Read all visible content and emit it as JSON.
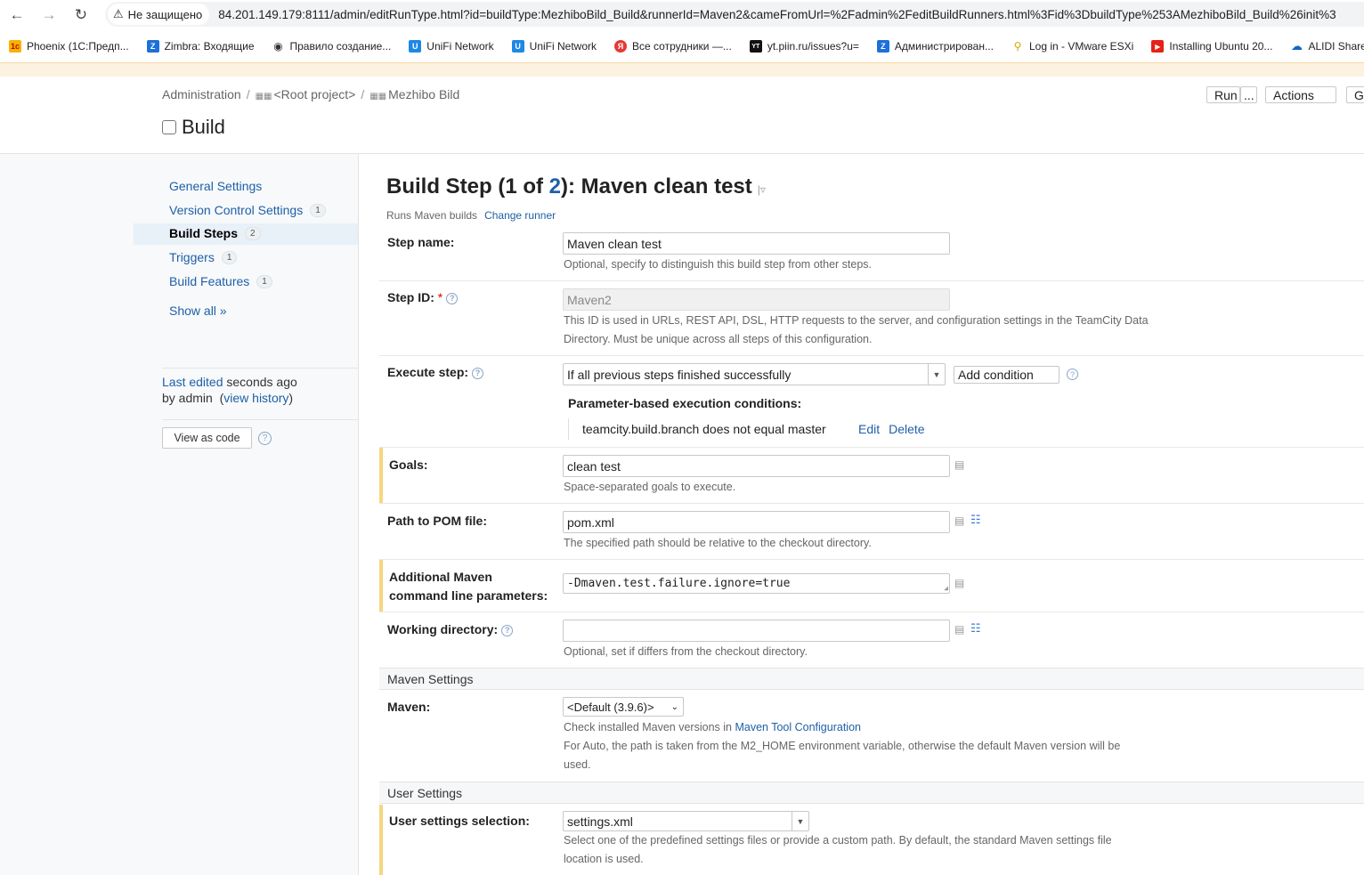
{
  "browser": {
    "security_label": "Не защищено",
    "url": "84.201.149.179:8111/admin/editRunType.html?id=buildType:MezhiboBild_Build&runnerId=Maven2&cameFromUrl=%2Fadmin%2FeditBuildRunners.html%3Fid%3DbuildType%253AMezhiboBild_Build%26init%3"
  },
  "bookmarks": [
    {
      "label": "Phoenix (1С:Предп...",
      "color": "#f5b400",
      "glyph": "1c"
    },
    {
      "label": "Zimbra: Входящие",
      "color": "#1e6fd9",
      "glyph": "Z"
    },
    {
      "label": "Правило создание...",
      "color": "#333333",
      "glyph": "◉"
    },
    {
      "label": "UniFi Network",
      "color": "#1e88e5",
      "glyph": "U"
    },
    {
      "label": "UniFi Network",
      "color": "#1e88e5",
      "glyph": "U"
    },
    {
      "label": "Все сотрудники —...",
      "color": "#e53935",
      "glyph": "Я"
    },
    {
      "label": "yt.piin.ru/issues?u=",
      "color": "#111111",
      "glyph": "YT"
    },
    {
      "label": "Администрирован...",
      "color": "#1e6fd9",
      "glyph": "Z"
    },
    {
      "label": "Log in - VMware ESXi",
      "color": "#f2c200",
      "glyph": "⚲"
    },
    {
      "label": "Installing Ubuntu 20...",
      "color": "#e62117",
      "glyph": "▶"
    },
    {
      "label": "ALIDI Share –",
      "color": "#1565c0",
      "glyph": "☁"
    }
  ],
  "breadcrumb": {
    "admin": "Administration",
    "sep": "/",
    "root": "<Root project>",
    "project": "Mezhibo Bild"
  },
  "page_title": "Build",
  "header_buttons": {
    "run": "Run",
    "run_more": "...",
    "actions": "Actions",
    "go": "Go"
  },
  "sidebar": {
    "items": [
      {
        "label": "General Settings",
        "badge": ""
      },
      {
        "label": "Version Control Settings",
        "badge": "1"
      },
      {
        "label": "Build Steps",
        "badge": "2"
      },
      {
        "label": "Triggers",
        "badge": "1"
      },
      {
        "label": "Build Features",
        "badge": "1"
      },
      {
        "label": "Show all »",
        "badge": ""
      }
    ],
    "last_edited_link": "Last edited",
    "last_edited_when": " seconds ago",
    "by_admin": "by admin",
    "view_history": "view history",
    "view_as_code": "View as code"
  },
  "main": {
    "title_prefix": "Build Step (1 of ",
    "title_num": "2",
    "title_suffix": "): Maven clean test",
    "runs_text": "Runs Maven builds",
    "change_runner": "Change runner"
  },
  "fields": {
    "step_name_label": "Step name:",
    "step_name_value": "Maven clean test",
    "step_name_hint": "Optional, specify to distinguish this build step from other steps.",
    "step_id_label": "Step ID:",
    "step_id_required": "*",
    "step_id_value": "Maven2",
    "step_id_hint1": "This ID is used in URLs, REST API, DSL, HTTP requests to the server, and configuration settings in the TeamCity Data",
    "step_id_hint2": "Directory. Must be unique across all steps of this configuration.",
    "execute_label": "Execute step:",
    "execute_value": "If all previous steps finished successfully",
    "add_condition": "Add condition",
    "cond_title": "Parameter-based execution conditions:",
    "cond_value": "teamcity.build.branch does not equal master",
    "cond_edit": "Edit",
    "cond_delete": "Delete",
    "goals_label": "Goals:",
    "goals_value": "clean test",
    "goals_hint": "Space-separated goals to execute.",
    "pom_label": "Path to POM file:",
    "pom_value": "pom.xml",
    "pom_hint": "The specified path should be relative to the checkout directory.",
    "params_label1": "Additional Maven",
    "params_label2": "command line parameters:",
    "params_value": "-Dmaven.test.failure.ignore=true",
    "workdir_label": "Working directory:",
    "workdir_value": "",
    "workdir_hint": "Optional, set if differs from the checkout directory.",
    "maven_section": "Maven Settings",
    "maven_label": "Maven:",
    "maven_value": "<Default (3.9.6)>",
    "maven_hint_pre": "Check installed Maven versions in ",
    "maven_hint_link": "Maven Tool Configuration",
    "maven_hint2a": "For Auto, the path is taken from the M2_HOME environment variable, otherwise the default Maven version will be",
    "maven_hint2b": "used.",
    "user_section": "User Settings",
    "user_label": "User settings selection:",
    "user_value": "settings.xml",
    "user_hint1": "Select one of the predefined settings files or provide a custom path. By default, the standard Maven settings file",
    "user_hint2": "location is used."
  }
}
